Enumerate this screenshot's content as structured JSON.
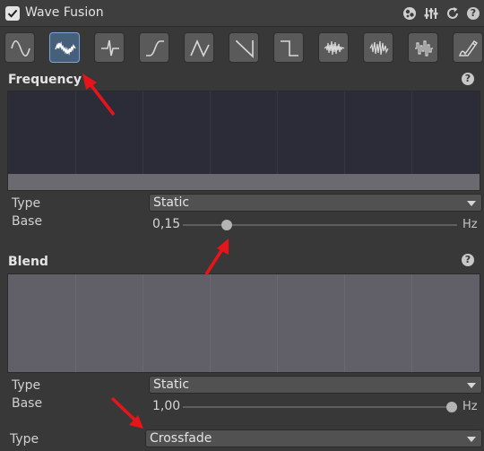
{
  "header": {
    "title": "Wave Fusion",
    "icons": [
      "checkbox-checked",
      "preset-icon",
      "sliders-icon",
      "reset-icon",
      "help-icon"
    ]
  },
  "wave_buttons": [
    {
      "name": "sine",
      "active": false
    },
    {
      "name": "noisy-sine",
      "active": true
    },
    {
      "name": "spike",
      "active": false
    },
    {
      "name": "s-curve",
      "active": false
    },
    {
      "name": "triangle",
      "active": false
    },
    {
      "name": "sawtooth",
      "active": false
    },
    {
      "name": "square",
      "active": false
    },
    {
      "name": "noise",
      "active": false
    },
    {
      "name": "noise-2",
      "active": false
    },
    {
      "name": "noise-3",
      "active": false
    },
    {
      "name": "custom-pen",
      "active": false
    }
  ],
  "frequency": {
    "title": "Frequency",
    "type_label": "Type",
    "type_value": "Static",
    "base_label": "Base",
    "base_value": "0,15",
    "base_fraction": 0.16,
    "unit": "Hz"
  },
  "blend": {
    "title": "Blend",
    "type_label": "Type",
    "type_value": "Static",
    "base_label": "Base",
    "base_value": "1,00",
    "base_fraction": 1.0,
    "unit": "Hz"
  },
  "blend_type": {
    "label": "Type",
    "value": "Crossfade"
  },
  "colors": {
    "panel_bg": "#383838",
    "frequency_graph_bg": "#2c2c38",
    "frequency_graph_fill": "#6a6a70",
    "blend_graph_bg": "#616069",
    "active_button": "#46607c",
    "annotation_arrow": "#e8141a"
  }
}
